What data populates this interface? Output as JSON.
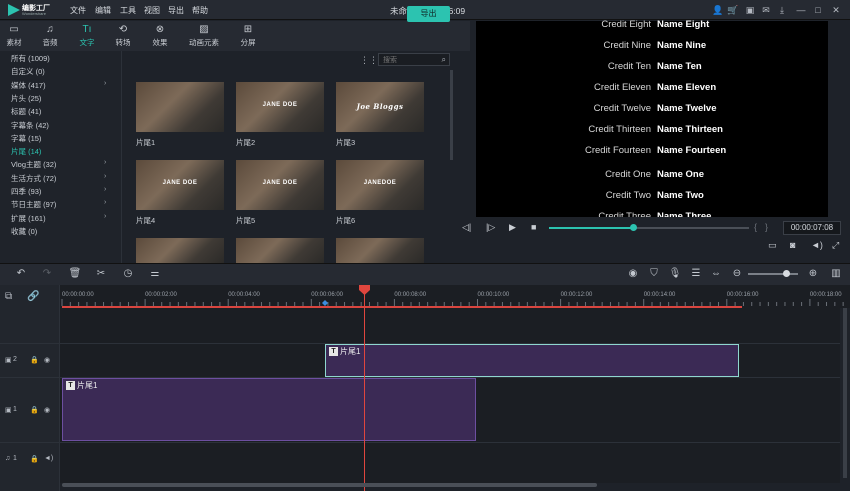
{
  "app": {
    "name": "编影工厂",
    "sub": "Wondershare",
    "project_title": "未命名: 00:00:16:09"
  },
  "menu": [
    "文件",
    "编辑",
    "工具",
    "视图",
    "导出",
    "帮助"
  ],
  "toolbar": {
    "tabs": [
      {
        "label": "素材",
        "icon": "folder-icon"
      },
      {
        "label": "音频",
        "icon": "music-note-icon"
      },
      {
        "label": "文字",
        "icon": "text-icon"
      },
      {
        "label": "转场",
        "icon": "transition-icon"
      },
      {
        "label": "效果",
        "icon": "effects-icon"
      },
      {
        "label": "动画元素",
        "icon": "image-icon"
      },
      {
        "label": "分屏",
        "icon": "split-screen-icon"
      }
    ],
    "active_tab": "文字",
    "export_label": "导出"
  },
  "categories": [
    {
      "label": "所有 (1009)",
      "arrow": false
    },
    {
      "label": "自定义 (0)",
      "arrow": false
    },
    {
      "label": "媒体 (417)",
      "arrow": true
    },
    {
      "label": "片头 (25)",
      "arrow": false
    },
    {
      "label": "标题 (41)",
      "arrow": false
    },
    {
      "label": "字幕条 (42)",
      "arrow": false
    },
    {
      "label": "字幕 (15)",
      "arrow": false
    },
    {
      "label": "片尾 (14)",
      "arrow": false,
      "active": true
    },
    {
      "label": "Vlog主题 (32)",
      "arrow": true
    },
    {
      "label": "生活方式 (72)",
      "arrow": true
    },
    {
      "label": "四季 (93)",
      "arrow": true
    },
    {
      "label": "节日主题 (97)",
      "arrow": true
    },
    {
      "label": "扩展 (161)",
      "arrow": true
    },
    {
      "label": "收藏 (0)",
      "arrow": false
    }
  ],
  "search": {
    "placeholder": "搜索"
  },
  "thumbnails": [
    {
      "label": "片尾1",
      "overlay": "",
      "style": "small"
    },
    {
      "label": "片尾2",
      "overlay": "JANE DOE",
      "style": "plain"
    },
    {
      "label": "片尾3",
      "overlay": "Joe Bloggs",
      "style": "script"
    },
    {
      "label": "片尾4",
      "overlay": "JANE DOE",
      "style": "plain"
    },
    {
      "label": "片尾5",
      "overlay": "JANE DOE",
      "style": "plain"
    },
    {
      "label": "片尾6",
      "overlay": "JANEDOE",
      "style": "plain"
    },
    {
      "label": "",
      "overlay": "",
      "style": "plain"
    },
    {
      "label": "",
      "overlay": "",
      "style": "small"
    },
    {
      "label": "",
      "overlay": "",
      "style": "small"
    }
  ],
  "credits": [
    {
      "role": "Credit Eight",
      "name": "Name  Eight"
    },
    {
      "role": "Credit Nine",
      "name": "Name  Nine"
    },
    {
      "role": "Credit Ten",
      "name": "Name  Ten"
    },
    {
      "role": "Credit Eleven",
      "name": "Name  Eleven"
    },
    {
      "role": "Credit Twelve",
      "name": "Name  Twelve"
    },
    {
      "role": "Credit Thirteen",
      "name": "Name  Thirteen"
    },
    {
      "role": "Credit Fourteen",
      "name": "Name  Fourteen"
    },
    {
      "role": "Credit One",
      "name": "Name  One"
    },
    {
      "role": "Credit Two",
      "name": "Name  Two"
    },
    {
      "role": "Credit Three",
      "name": "Name  Three"
    }
  ],
  "player": {
    "timecode": "00:00:07:08",
    "progress": 0.42
  },
  "ruler": {
    "ticks": [
      "00:00:00:00",
      "00:00:02:00",
      "00:00:04:00",
      "00:00:06:00",
      "00:00:08:00",
      "00:00:10:00",
      "00:00:12:00",
      "00:00:14:00",
      "00:00:16:00",
      "00:00:18:00"
    ]
  },
  "tracks": [
    {
      "id": "2",
      "clip": "片尾1"
    },
    {
      "id": "1",
      "clip": "片尾1"
    },
    {
      "id": "1",
      "type": "audio"
    }
  ]
}
